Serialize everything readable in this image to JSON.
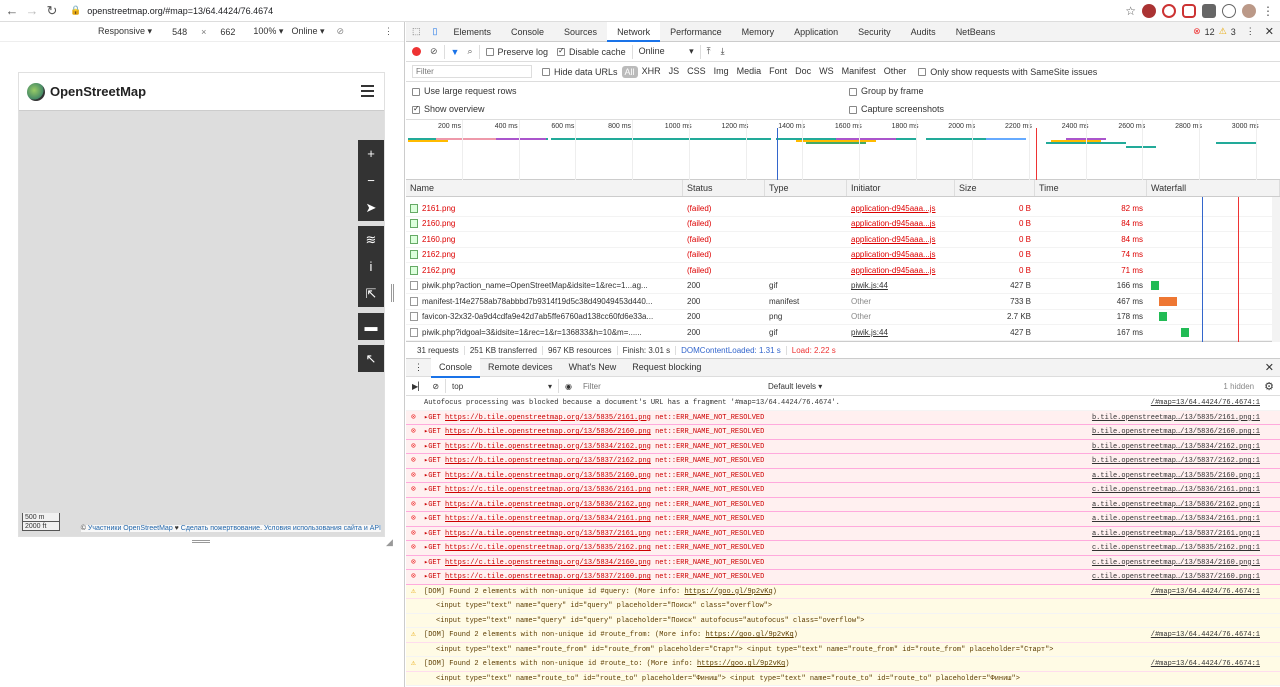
{
  "browser": {
    "url": "openstreetmap.org/#map=13/64.4424/76.4674"
  },
  "device_toolbar": {
    "preset": "Responsive",
    "width": "548",
    "x": "×",
    "height": "662",
    "zoom": "100%",
    "throttle": "Online"
  },
  "osm": {
    "title": "OpenStreetMap",
    "scale_m": "500 m",
    "scale_ft": "2000 ft",
    "attrib_prefix": "© ",
    "attrib_contrib": "Участники OpenStreetMap",
    "attrib_heart": " ♥ ",
    "attrib_donate": "Сделать пожертвование",
    "attrib_sep": ". ",
    "attrib_terms": "Условия использования сайта и API"
  },
  "devtools": {
    "tabs": [
      "Elements",
      "Console",
      "Sources",
      "Network",
      "Performance",
      "Memory",
      "Application",
      "Security",
      "Audits",
      "NetBeans"
    ],
    "errors": "12",
    "warnings": "3",
    "preserve_log": "Preserve log",
    "disable_cache": "Disable cache",
    "online": "Online",
    "filter_placeholder": "Filter",
    "hide_data_urls": "Hide data URLs",
    "types": [
      "All",
      "XHR",
      "JS",
      "CSS",
      "Img",
      "Media",
      "Font",
      "Doc",
      "WS",
      "Manifest",
      "Other"
    ],
    "samesite": "Only show requests with SameSite issues",
    "large_rows": "Use large request rows",
    "group_frame": "Group by frame",
    "show_overview": "Show overview",
    "capture_screens": "Capture screenshots",
    "ticks": [
      "200 ms",
      "400 ms",
      "600 ms",
      "800 ms",
      "1000 ms",
      "1200 ms",
      "1400 ms",
      "1600 ms",
      "1800 ms",
      "2000 ms",
      "2200 ms",
      "2400 ms",
      "2600 ms",
      "2800 ms",
      "3000 ms"
    ],
    "columns": [
      "Name",
      "Status",
      "Type",
      "Initiator",
      "Size",
      "Time",
      "Waterfall"
    ],
    "rows": [
      {
        "name": "2161.png",
        "status": "(failed)",
        "type": "",
        "initiator": "application-d945aaa...js",
        "size": "0 B",
        "time": "82 ms",
        "failed": true
      },
      {
        "name": "2160.png",
        "status": "(failed)",
        "type": "",
        "initiator": "application-d945aaa...js",
        "size": "0 B",
        "time": "84 ms",
        "failed": true
      },
      {
        "name": "2160.png",
        "status": "(failed)",
        "type": "",
        "initiator": "application-d945aaa...js",
        "size": "0 B",
        "time": "84 ms",
        "failed": true
      },
      {
        "name": "2162.png",
        "status": "(failed)",
        "type": "",
        "initiator": "application-d945aaa...js",
        "size": "0 B",
        "time": "74 ms",
        "failed": true
      },
      {
        "name": "2162.png",
        "status": "(failed)",
        "type": "",
        "initiator": "application-d945aaa...js",
        "size": "0 B",
        "time": "71 ms",
        "failed": true
      },
      {
        "name": "piwik.php?action_name=OpenStreetMap&idsite=1&rec=1...ag...",
        "status": "200",
        "type": "gif",
        "initiator": "piwik.js:44",
        "size": "427 B",
        "time": "166 ms",
        "failed": false
      },
      {
        "name": "manifest-1f4e2758ab78abbbd7b9314f19d5c38d49049453d440...",
        "status": "200",
        "type": "manifest",
        "initiator": "Other",
        "size": "733 B",
        "time": "467 ms",
        "failed": false
      },
      {
        "name": "favicon-32x32-0a9d4cdfa9e42d7ab5ffe6760ad138cc60fd6e33a...",
        "status": "200",
        "type": "png",
        "initiator": "Other",
        "size": "2.7 KB",
        "time": "178 ms",
        "failed": false
      },
      {
        "name": "piwik.php?idgoal=3&idsite=1&rec=1&r=136833&h=10&m=......",
        "status": "200",
        "type": "gif",
        "initiator": "piwik.js:44",
        "size": "427 B",
        "time": "167 ms",
        "failed": false
      }
    ],
    "status_bar": {
      "requests": "31 requests",
      "transferred": "251 KB transferred",
      "resources": "967 KB resources",
      "finish": "Finish: 3.01 s",
      "dcl": "DOMContentLoaded: 1.31 s",
      "load": "Load: 2.22 s"
    },
    "drawer_tabs": [
      "Console",
      "Remote devices",
      "What's New",
      "Request blocking"
    ],
    "context": "top",
    "console_filter": "Filter",
    "levels": "Default levels ▾",
    "hidden": "1 hidden",
    "console": [
      {
        "kind": "info",
        "text": "Autofocus processing was blocked because a document's URL has a fragment '#map=13/64.4424/76.4674'.",
        "src": "/#map=13/64.4424/76.4674:1"
      },
      {
        "kind": "err",
        "pre": "▸GET ",
        "link": "https://b.tile.openstreetmap.org/13/5835/2161.png",
        "post": " net::ERR_NAME_NOT_RESOLVED",
        "src": "b.tile.openstreetmap…/13/5835/2161.png:1"
      },
      {
        "kind": "err",
        "pre": "▸GET ",
        "link": "https://b.tile.openstreetmap.org/13/5836/2160.png",
        "post": " net::ERR_NAME_NOT_RESOLVED",
        "src": "b.tile.openstreetmap…/13/5836/2160.png:1"
      },
      {
        "kind": "err",
        "pre": "▸GET ",
        "link": "https://b.tile.openstreetmap.org/13/5834/2162.png",
        "post": " net::ERR_NAME_NOT_RESOLVED",
        "src": "b.tile.openstreetmap…/13/5834/2162.png:1"
      },
      {
        "kind": "err",
        "pre": "▸GET ",
        "link": "https://b.tile.openstreetmap.org/13/5837/2162.png",
        "post": " net::ERR_NAME_NOT_RESOLVED",
        "src": "b.tile.openstreetmap…/13/5837/2162.png:1"
      },
      {
        "kind": "err",
        "pre": "▸GET ",
        "link": "https://a.tile.openstreetmap.org/13/5835/2160.png",
        "post": " net::ERR_NAME_NOT_RESOLVED",
        "src": "a.tile.openstreetmap…/13/5835/2160.png:1"
      },
      {
        "kind": "err",
        "pre": "▸GET ",
        "link": "https://c.tile.openstreetmap.org/13/5836/2161.png",
        "post": " net::ERR_NAME_NOT_RESOLVED",
        "src": "c.tile.openstreetmap…/13/5836/2161.png:1"
      },
      {
        "kind": "err",
        "pre": "▸GET ",
        "link": "https://a.tile.openstreetmap.org/13/5836/2162.png",
        "post": " net::ERR_NAME_NOT_RESOLVED",
        "src": "a.tile.openstreetmap…/13/5836/2162.png:1"
      },
      {
        "kind": "err",
        "pre": "▸GET ",
        "link": "https://a.tile.openstreetmap.org/13/5834/2161.png",
        "post": " net::ERR_NAME_NOT_RESOLVED",
        "src": "a.tile.openstreetmap…/13/5834/2161.png:1"
      },
      {
        "kind": "err",
        "pre": "▸GET ",
        "link": "https://a.tile.openstreetmap.org/13/5837/2161.png",
        "post": " net::ERR_NAME_NOT_RESOLVED",
        "src": "a.tile.openstreetmap…/13/5837/2161.png:1"
      },
      {
        "kind": "err",
        "pre": "▸GET ",
        "link": "https://c.tile.openstreetmap.org/13/5835/2162.png",
        "post": " net::ERR_NAME_NOT_RESOLVED",
        "src": "c.tile.openstreetmap…/13/5835/2162.png:1"
      },
      {
        "kind": "err",
        "pre": "▸GET ",
        "link": "https://c.tile.openstreetmap.org/13/5834/2160.png",
        "post": " net::ERR_NAME_NOT_RESOLVED",
        "src": "c.tile.openstreetmap…/13/5834/2160.png:1"
      },
      {
        "kind": "err",
        "pre": "▸GET ",
        "link": "https://c.tile.openstreetmap.org/13/5837/2160.png",
        "post": " net::ERR_NAME_NOT_RESOLVED",
        "src": "c.tile.openstreetmap…/13/5837/2160.png:1"
      },
      {
        "kind": "warn",
        "pre": "[DOM] Found 2 elements with non-unique id #query: (More info: ",
        "link": "https://goo.gl/9p2vKq",
        "post": ")",
        "src": "/#map=13/64.4424/76.4674:1"
      },
      {
        "kind": "sub",
        "text": "<input type=\"text\" name=\"query\" id=\"query\" placeholder=\"Поиск\" class=\"overflow\">"
      },
      {
        "kind": "sub",
        "text": "<input type=\"text\" name=\"query\" id=\"query\" placeholder=\"Поиск\" autofocus=\"autofocus\" class=\"overflow\">"
      },
      {
        "kind": "warn",
        "pre": "[DOM] Found 2 elements with non-unique id #route_from: (More info: ",
        "link": "https://goo.gl/9p2vKq",
        "post": ")",
        "src": "/#map=13/64.4424/76.4674:1"
      },
      {
        "kind": "sub",
        "text": "<input type=\"text\" name=\"route_from\" id=\"route_from\" placeholder=\"Старт\">   <input type=\"text\" name=\"route_from\" id=\"route_from\" placeholder=\"Старт\">"
      },
      {
        "kind": "warn",
        "pre": "[DOM] Found 2 elements with non-unique id #route_to: (More info: ",
        "link": "https://goo.gl/9p2vKq",
        "post": ")",
        "src": "/#map=13/64.4424/76.4674:1"
      },
      {
        "kind": "sub",
        "text": "<input type=\"text\" name=\"route_to\" id=\"route_to\" placeholder=\"Финиш\">   <input type=\"text\" name=\"route_to\" id=\"route_to\" placeholder=\"Финиш\">"
      }
    ]
  }
}
